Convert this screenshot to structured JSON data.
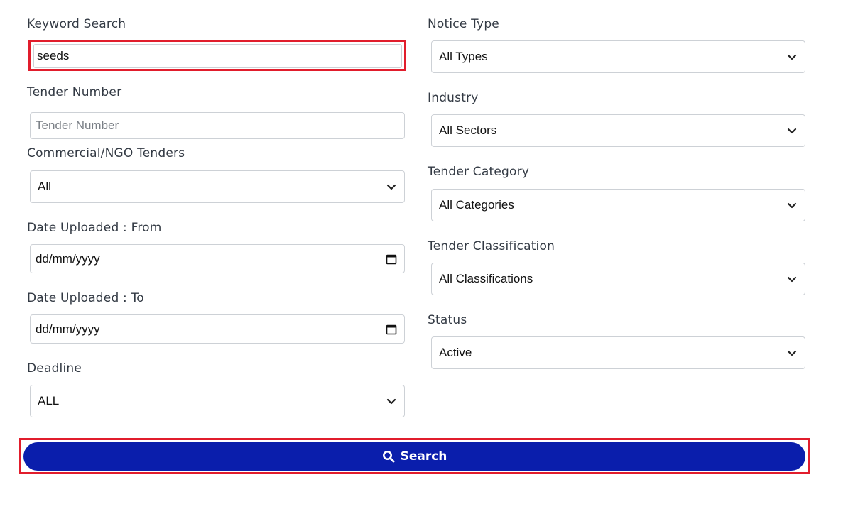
{
  "left": {
    "keyword": {
      "label": "Keyword Search",
      "value": "seeds"
    },
    "tender_number": {
      "label": "Tender Number",
      "placeholder": "Tender Number"
    },
    "commercial": {
      "label": "Commercial/NGO Tenders",
      "selected": "All"
    },
    "date_from": {
      "label": "Date Uploaded : From",
      "value": "dd/mm/yyyy"
    },
    "date_to": {
      "label": "Date Uploaded : To",
      "value": "dd/mm/yyyy"
    },
    "deadline": {
      "label": "Deadline",
      "selected": "ALL"
    }
  },
  "right": {
    "notice_type": {
      "label": "Notice Type",
      "selected": "All Types"
    },
    "industry": {
      "label": "Industry",
      "selected": "All Sectors"
    },
    "category": {
      "label": "Tender Category",
      "selected": "All Categories"
    },
    "classification": {
      "label": "Tender Classification",
      "selected": "All Classifications"
    },
    "status": {
      "label": "Status",
      "selected": "Active"
    }
  },
  "search_button": {
    "label": "Search",
    "icon": "search-icon",
    "color": "#0a1eac"
  },
  "highlight_color": "#e11d2c"
}
